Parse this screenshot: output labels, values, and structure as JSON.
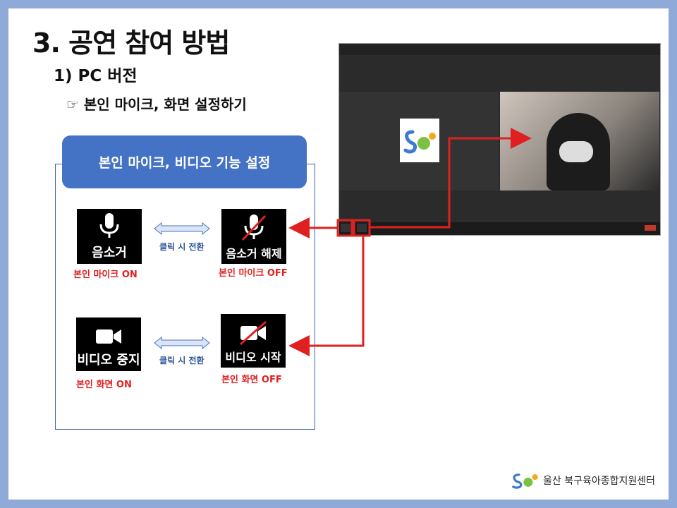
{
  "slide": {
    "title": "3. 공연 참여 방법",
    "subtitle": "1) PC 버전",
    "bullet": "☞ 본인 마이크, 화면 설정하기"
  },
  "panel": {
    "header": "본인 마이크, 비디오 기능 설정",
    "swap_label": "클릭 시 전환",
    "mic_on": {
      "label": "음소거",
      "caption": "본인 마이크 ON"
    },
    "mic_off": {
      "label": "음소거 해제",
      "caption": "본인 마이크 OFF"
    },
    "video_on": {
      "label": "비디오 중지",
      "caption": "본인 화면 ON"
    },
    "video_off": {
      "label": "비디오 시작",
      "caption": "본인 화면 OFF"
    }
  },
  "footer": {
    "org": "울산 북구육아종합지원센터"
  },
  "colors": {
    "accent": "#4472c4",
    "arrow_red": "#e02020",
    "frame": "#8fa9d9"
  },
  "icons": [
    "microphone-icon",
    "microphone-muted-icon",
    "video-camera-icon",
    "video-camera-off-icon",
    "double-arrow-icon",
    "org-logo-icon"
  ]
}
